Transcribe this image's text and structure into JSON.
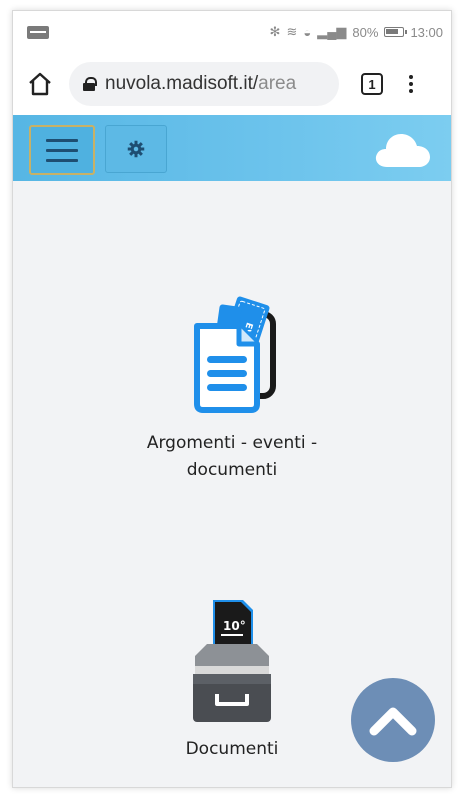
{
  "status_bar": {
    "battery": "80%",
    "time": "13:00"
  },
  "browser": {
    "url_main": "nuvola.madisoft.it/",
    "url_cut": "area",
    "tab_count": "1"
  },
  "tiles": [
    {
      "label_line1": "Argomenti - eventi -",
      "label_line2": "documenti",
      "icon": "document-event-icon"
    },
    {
      "label": "Documenti",
      "icon": "document-tray-icon"
    }
  ],
  "icons": {
    "home": "home-icon",
    "menu": "hamburger-icon",
    "settings": "gear-icon",
    "cloud": "cloud-icon",
    "scroll_top": "chevron-up-icon"
  },
  "colors": {
    "header": "#6cc3ec",
    "scroll_button": "#6d8eb6",
    "icon_blue": "#1f8fea"
  }
}
